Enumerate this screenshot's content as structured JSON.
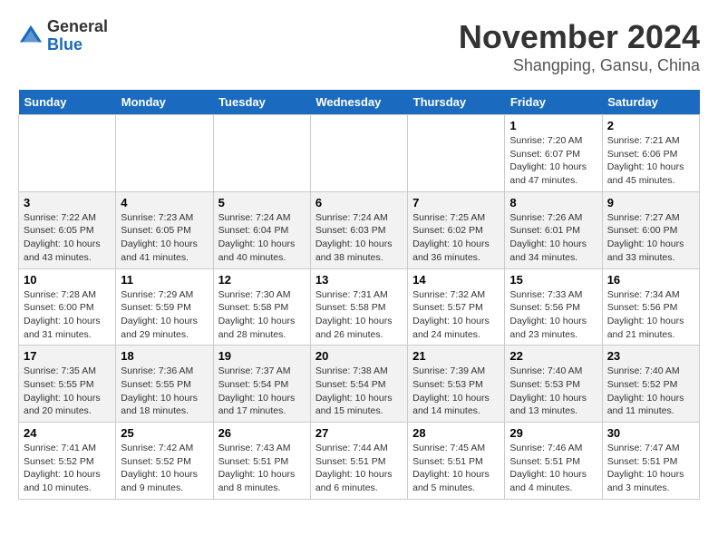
{
  "header": {
    "logo_general": "General",
    "logo_blue": "Blue",
    "month_title": "November 2024",
    "location": "Shangping, Gansu, China"
  },
  "weekdays": [
    "Sunday",
    "Monday",
    "Tuesday",
    "Wednesday",
    "Thursday",
    "Friday",
    "Saturday"
  ],
  "weeks": [
    [
      {
        "day": "",
        "info": ""
      },
      {
        "day": "",
        "info": ""
      },
      {
        "day": "",
        "info": ""
      },
      {
        "day": "",
        "info": ""
      },
      {
        "day": "",
        "info": ""
      },
      {
        "day": "1",
        "info": "Sunrise: 7:20 AM\nSunset: 6:07 PM\nDaylight: 10 hours and 47 minutes."
      },
      {
        "day": "2",
        "info": "Sunrise: 7:21 AM\nSunset: 6:06 PM\nDaylight: 10 hours and 45 minutes."
      }
    ],
    [
      {
        "day": "3",
        "info": "Sunrise: 7:22 AM\nSunset: 6:05 PM\nDaylight: 10 hours and 43 minutes."
      },
      {
        "day": "4",
        "info": "Sunrise: 7:23 AM\nSunset: 6:05 PM\nDaylight: 10 hours and 41 minutes."
      },
      {
        "day": "5",
        "info": "Sunrise: 7:24 AM\nSunset: 6:04 PM\nDaylight: 10 hours and 40 minutes."
      },
      {
        "day": "6",
        "info": "Sunrise: 7:24 AM\nSunset: 6:03 PM\nDaylight: 10 hours and 38 minutes."
      },
      {
        "day": "7",
        "info": "Sunrise: 7:25 AM\nSunset: 6:02 PM\nDaylight: 10 hours and 36 minutes."
      },
      {
        "day": "8",
        "info": "Sunrise: 7:26 AM\nSunset: 6:01 PM\nDaylight: 10 hours and 34 minutes."
      },
      {
        "day": "9",
        "info": "Sunrise: 7:27 AM\nSunset: 6:00 PM\nDaylight: 10 hours and 33 minutes."
      }
    ],
    [
      {
        "day": "10",
        "info": "Sunrise: 7:28 AM\nSunset: 6:00 PM\nDaylight: 10 hours and 31 minutes."
      },
      {
        "day": "11",
        "info": "Sunrise: 7:29 AM\nSunset: 5:59 PM\nDaylight: 10 hours and 29 minutes."
      },
      {
        "day": "12",
        "info": "Sunrise: 7:30 AM\nSunset: 5:58 PM\nDaylight: 10 hours and 28 minutes."
      },
      {
        "day": "13",
        "info": "Sunrise: 7:31 AM\nSunset: 5:58 PM\nDaylight: 10 hours and 26 minutes."
      },
      {
        "day": "14",
        "info": "Sunrise: 7:32 AM\nSunset: 5:57 PM\nDaylight: 10 hours and 24 minutes."
      },
      {
        "day": "15",
        "info": "Sunrise: 7:33 AM\nSunset: 5:56 PM\nDaylight: 10 hours and 23 minutes."
      },
      {
        "day": "16",
        "info": "Sunrise: 7:34 AM\nSunset: 5:56 PM\nDaylight: 10 hours and 21 minutes."
      }
    ],
    [
      {
        "day": "17",
        "info": "Sunrise: 7:35 AM\nSunset: 5:55 PM\nDaylight: 10 hours and 20 minutes."
      },
      {
        "day": "18",
        "info": "Sunrise: 7:36 AM\nSunset: 5:55 PM\nDaylight: 10 hours and 18 minutes."
      },
      {
        "day": "19",
        "info": "Sunrise: 7:37 AM\nSunset: 5:54 PM\nDaylight: 10 hours and 17 minutes."
      },
      {
        "day": "20",
        "info": "Sunrise: 7:38 AM\nSunset: 5:54 PM\nDaylight: 10 hours and 15 minutes."
      },
      {
        "day": "21",
        "info": "Sunrise: 7:39 AM\nSunset: 5:53 PM\nDaylight: 10 hours and 14 minutes."
      },
      {
        "day": "22",
        "info": "Sunrise: 7:40 AM\nSunset: 5:53 PM\nDaylight: 10 hours and 13 minutes."
      },
      {
        "day": "23",
        "info": "Sunrise: 7:40 AM\nSunset: 5:52 PM\nDaylight: 10 hours and 11 minutes."
      }
    ],
    [
      {
        "day": "24",
        "info": "Sunrise: 7:41 AM\nSunset: 5:52 PM\nDaylight: 10 hours and 10 minutes."
      },
      {
        "day": "25",
        "info": "Sunrise: 7:42 AM\nSunset: 5:52 PM\nDaylight: 10 hours and 9 minutes."
      },
      {
        "day": "26",
        "info": "Sunrise: 7:43 AM\nSunset: 5:51 PM\nDaylight: 10 hours and 8 minutes."
      },
      {
        "day": "27",
        "info": "Sunrise: 7:44 AM\nSunset: 5:51 PM\nDaylight: 10 hours and 6 minutes."
      },
      {
        "day": "28",
        "info": "Sunrise: 7:45 AM\nSunset: 5:51 PM\nDaylight: 10 hours and 5 minutes."
      },
      {
        "day": "29",
        "info": "Sunrise: 7:46 AM\nSunset: 5:51 PM\nDaylight: 10 hours and 4 minutes."
      },
      {
        "day": "30",
        "info": "Sunrise: 7:47 AM\nSunset: 5:51 PM\nDaylight: 10 hours and 3 minutes."
      }
    ]
  ]
}
